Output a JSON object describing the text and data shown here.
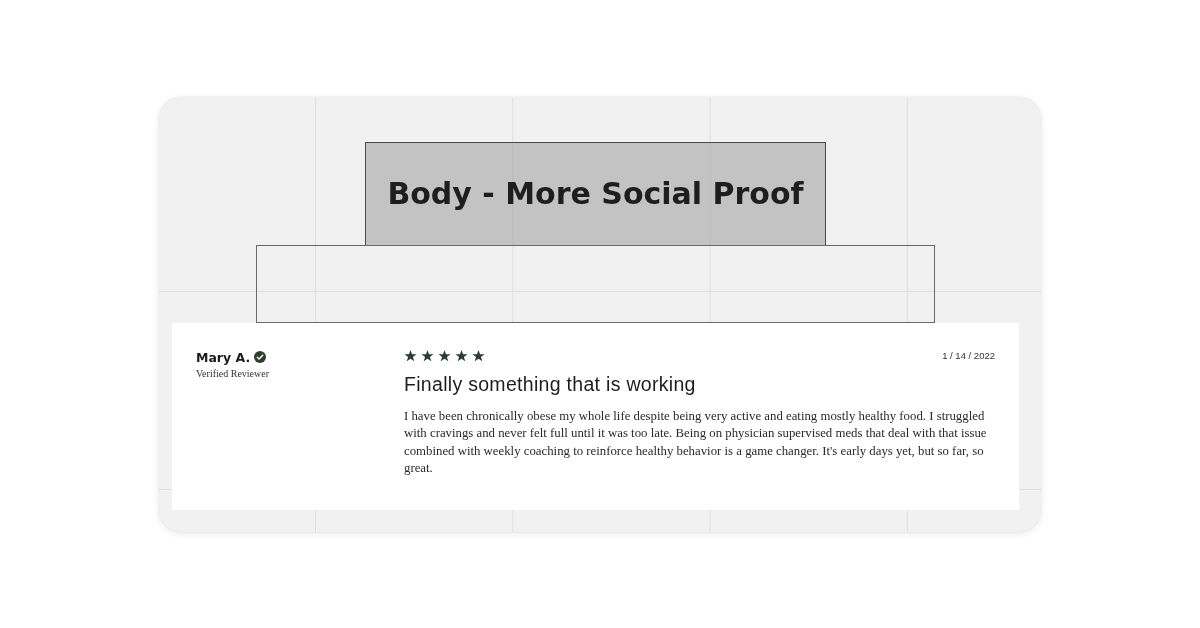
{
  "section_title": "Body - More Social Proof",
  "review": {
    "reviewer": {
      "name": "Mary A.",
      "verified": true,
      "badge": "Verified Reviewer"
    },
    "stars": 5,
    "date": "1 / 14 / 2022",
    "title": "Finally something that is working",
    "body": "I have been chronically obese my whole life despite being very active and eating mostly healthy food. I struggled with cravings and never felt full until it was too late. Being on physician supervised meds that deal with that issue combined with weekly coaching to reinforce healthy behavior is a game changer. It's early days yet, but so far, so great."
  }
}
